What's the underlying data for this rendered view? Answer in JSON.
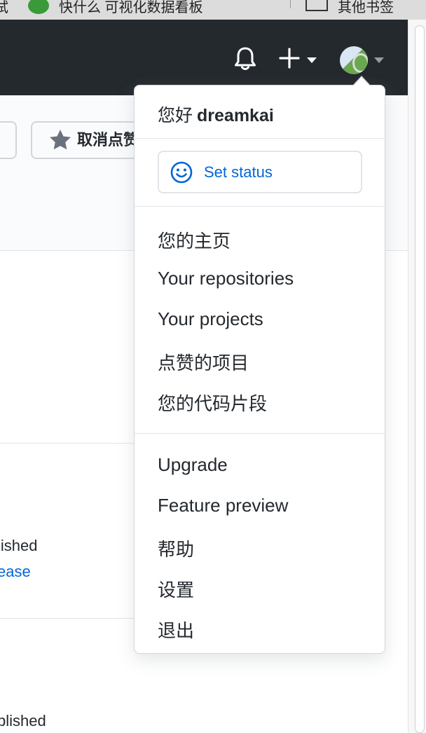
{
  "bookmarks": {
    "item1": "试",
    "item2": "快什么 可视化数据看板",
    "item3": "其他书签"
  },
  "page": {
    "star_button_label": "取消点赞",
    "text_1": "lished",
    "text_2": "ease",
    "text_3": "blished"
  },
  "dropdown": {
    "greeting_prefix": "您好",
    "username": "dreamkai",
    "set_status": "Set status",
    "section1": [
      "您的主页",
      "Your repositories",
      "Your projects",
      "点赞的项目",
      "您的代码片段"
    ],
    "section2": [
      "Upgrade",
      "Feature preview",
      "帮助",
      "设置",
      "退出"
    ]
  },
  "icons": {
    "bell": "bell-icon",
    "plus": "plus-icon",
    "star": "star-icon",
    "smiley": "smiley-icon"
  },
  "colors": {
    "header_bg": "#24292e",
    "link_blue": "#0366d6",
    "text": "#24292e"
  }
}
